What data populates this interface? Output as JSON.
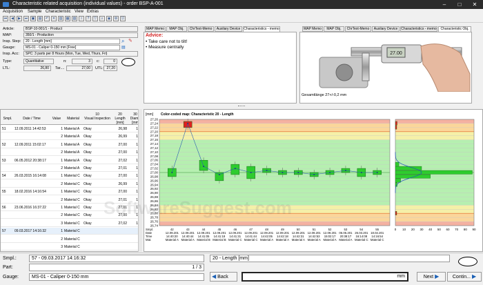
{
  "window": {
    "title": "Characteristic related acquisition (individual values) - order BSP-A-001"
  },
  "menu": [
    "Acquisition",
    "Sample",
    "Characteristic",
    "View",
    "Extras"
  ],
  "header": {
    "article_label": "Article:",
    "article": "BSP-10-001/1 - Product",
    "map_label": "MAP:",
    "map": "350/1 - Production",
    "insp_step_label": "Insp. Step:",
    "insp_step": "20 - Length [mm]",
    "gauge_label": "Gauge:",
    "gauge": "MS-01 - Caliper 0-150 mm [Free]",
    "insp_acc_label": "Insp. Acc:",
    "insp_acc": "SPC: 3 parts per 8 Hours (Mon, Tue, Wed, Thurs, Fri)",
    "type_label": "Type:",
    "type": "Quantitative",
    "n_label": "n:",
    "n": "3",
    "c_label": "c:",
    "c": "0",
    "ltl_label": "LTL:",
    "ltl": "26,80",
    "tar_label": "Tar....",
    "tar": "27,00",
    "utl_label": "UTL:",
    "utl": "27,20"
  },
  "middle_panel": {
    "tabs": [
      "MAP Memo",
      "MAP Obj.",
      "ChrText-Memo",
      "Auxilary Device",
      "Characteristics - memo"
    ],
    "advice_title": "Advice:",
    "advice_items": [
      "Take care not to tilt!",
      "Measure centrally"
    ]
  },
  "right_panel": {
    "tabs": [
      "MAP Memo",
      "MAP Obj.",
      "ChrText-Memo",
      "Auxilary Device",
      "Characteristics - memo",
      "Characteristic Obj."
    ],
    "caption": "Gesamtlänge 27+/-0,2 mm",
    "caliper_display": "27.00"
  },
  "table": {
    "headers": {
      "smpl": "Smpl.",
      "datetime": "Date / Time",
      "value": "Value",
      "material": "Material",
      "visual_no": "10",
      "visual": "Visual Inspection",
      "length_no": "20",
      "length": "Length [mm]",
      "diam_no": "30",
      "diam": "Diame [mm"
    },
    "rows": [
      {
        "smpl": "51",
        "date": "12.09.2011 14:42:53",
        "v": "1",
        "mat": "Material A",
        "vis": "Okay",
        "len": "26,98",
        "d": "1"
      },
      {
        "smpl": "",
        "date": "",
        "v": "2",
        "mat": "Material A",
        "vis": "Okay",
        "len": "26,99",
        "d": "1"
      },
      {
        "smpl": "52",
        "date": "12.09.2011 15:02:17",
        "v": "1",
        "mat": "Material A",
        "vis": "Okay",
        "len": "27,00",
        "d": "1"
      },
      {
        "smpl": "",
        "date": "",
        "v": "2",
        "mat": "Material A",
        "vis": "Okay",
        "len": "27,00",
        "d": "1"
      },
      {
        "smpl": "53",
        "date": "06.05.2012 20:38:17",
        "v": "1",
        "mat": "Material A",
        "vis": "Okay",
        "len": "27,02",
        "d": "1"
      },
      {
        "smpl": "",
        "date": "",
        "v": "2",
        "mat": "Material A",
        "vis": "Okay",
        "len": "27,01",
        "d": "1"
      },
      {
        "smpl": "54",
        "date": "26.03.2015 16:14:08",
        "v": "1",
        "mat": "Material C",
        "vis": "Okay",
        "len": "27,00",
        "d": "1"
      },
      {
        "smpl": "",
        "date": "",
        "v": "2",
        "mat": "Material C",
        "vis": "Okay",
        "len": "26,99",
        "d": "1"
      },
      {
        "smpl": "55",
        "date": "18.02.2016 14:16:54",
        "v": "1",
        "mat": "Material C",
        "vis": "Okay",
        "len": "27,00",
        "d": "1"
      },
      {
        "smpl": "",
        "date": "",
        "v": "2",
        "mat": "Material C",
        "vis": "Okay",
        "len": "27,01",
        "d": "1"
      },
      {
        "smpl": "56",
        "date": "23.06.2016 16:37:22",
        "v": "1",
        "mat": "Material C",
        "vis": "Okay",
        "len": "27,01",
        "d": "1"
      },
      {
        "smpl": "",
        "date": "",
        "v": "2",
        "mat": "Material C",
        "vis": "Okay",
        "len": "27,00",
        "d": "1"
      },
      {
        "smpl": "",
        "date": "",
        "v": "3",
        "mat": "Material C",
        "vis": "Okay",
        "len": "27,02",
        "d": "1"
      },
      {
        "smpl": "57",
        "date": "09.03.2017 14:16:32",
        "v": "1",
        "mat": "Material C",
        "vis": "",
        "len": "",
        "d": ""
      },
      {
        "smpl": "",
        "date": "",
        "v": "2",
        "mat": "Material C",
        "vis": "",
        "len": "",
        "d": ""
      },
      {
        "smpl": "",
        "date": "",
        "v": "3",
        "mat": "Material C",
        "vis": "",
        "len": "",
        "d": ""
      }
    ]
  },
  "chart_data": {
    "type": "box",
    "title": "Color-coded map: Characteristic 20 - Length",
    "ylabel": "[mm]",
    "ylim": [
      26.74,
      27.26
    ],
    "yticks": [
      "27,26",
      "27,24",
      "27,22",
      "27,20",
      "27,18",
      "27,16",
      "27,14",
      "27,12",
      "27,10",
      "27,08",
      "27,06",
      "27,04",
      "27,02",
      "27,00",
      "26,98",
      "26,96",
      "26,94",
      "26,92",
      "26,90",
      "26,88",
      "26,86",
      "26,84",
      "26,82",
      "26,80",
      "26,78",
      "26,76",
      "26,74"
    ],
    "spec": {
      "ltl": 26.8,
      "target": 27.0,
      "utl": 27.2
    },
    "row_labels": [
      "Smpl.",
      "Date",
      "Time",
      "Mat."
    ],
    "samples": [
      {
        "smpl": "42",
        "date": "12.09.201",
        "time": "14:40:20",
        "mat": "Material A",
        "mean": 27.0,
        "min": 26.98,
        "max": 27.02,
        "alarm": false
      },
      {
        "smpl": "43",
        "date": "12.09.201",
        "time": "14:40:44",
        "mat": "Material A",
        "mean": 27.24,
        "min": 27.22,
        "max": 27.25,
        "alarm": true
      },
      {
        "smpl": "44",
        "date": "12.09.201",
        "time": "14:41:05",
        "mat": "Material B",
        "mean": 27.03,
        "min": 27.01,
        "max": 27.06,
        "alarm": false
      },
      {
        "smpl": "45",
        "date": "12.09.201",
        "time": "14:41:18",
        "mat": "Material B",
        "mean": 26.99,
        "min": 26.96,
        "max": 27.0,
        "alarm": false
      },
      {
        "smpl": "46",
        "date": "12.09.201",
        "time": "14:41:31",
        "mat": "Material C",
        "mean": 27.02,
        "min": 26.99,
        "max": 27.04,
        "alarm": false
      },
      {
        "smpl": "47",
        "date": "12.09.201",
        "time": "14:41:44",
        "mat": "Material C",
        "mean": 27.0,
        "min": 26.97,
        "max": 27.03,
        "alarm": false
      },
      {
        "smpl": "48",
        "date": "12.09.201",
        "time": "14:42:05",
        "mat": "Material A",
        "mean": 27.01,
        "min": 27.0,
        "max": 27.02,
        "alarm": false
      },
      {
        "smpl": "49",
        "date": "12.09.201",
        "time": "14:42:18",
        "mat": "Material A",
        "mean": 27.0,
        "min": 26.99,
        "max": 27.01,
        "alarm": false
      },
      {
        "smpl": "50",
        "date": "12.09.201",
        "time": "14:42:31",
        "mat": "Material A",
        "mean": 27.0,
        "min": 26.99,
        "max": 27.01,
        "alarm": false
      },
      {
        "smpl": "51",
        "date": "12.09.201",
        "time": "14:42:53",
        "mat": "Material A",
        "mean": 26.99,
        "min": 26.98,
        "max": 27.0,
        "alarm": false
      },
      {
        "smpl": "52",
        "date": "12.09.201",
        "time": "15:02:17",
        "mat": "Material A",
        "mean": 27.0,
        "min": 26.99,
        "max": 27.01,
        "alarm": false
      },
      {
        "smpl": "53",
        "date": "06.05.201",
        "time": "20:38:17",
        "mat": "Material A",
        "mean": 27.01,
        "min": 27.0,
        "max": 27.02,
        "alarm": false
      },
      {
        "smpl": "54",
        "date": "26.03.201",
        "time": "16:14:08",
        "mat": "Material C",
        "mean": 27.0,
        "min": 26.98,
        "max": 27.02,
        "alarm": false
      },
      {
        "smpl": "55",
        "date": "18.02.201",
        "time": "14:16:54",
        "mat": "Material C",
        "mean": 27.0,
        "min": 26.99,
        "max": 27.01,
        "alarm": false
      }
    ],
    "histogram": {
      "xticks": [
        "0",
        "10",
        "20",
        "30",
        "40",
        "50",
        "60",
        "70",
        "80",
        "90"
      ],
      "bins": [
        {
          "y": 27.24,
          "count": 2,
          "alarm": true
        },
        {
          "y": 27.22,
          "count": 1,
          "alarm": true
        },
        {
          "y": 27.04,
          "count": 4,
          "alarm": false
        },
        {
          "y": 27.02,
          "count": 30,
          "alarm": false
        },
        {
          "y": 27.0,
          "count": 88,
          "alarm": false
        },
        {
          "y": 26.98,
          "count": 40,
          "alarm": false
        },
        {
          "y": 26.96,
          "count": 6,
          "alarm": false
        },
        {
          "y": 26.94,
          "count": 2,
          "alarm": false
        },
        {
          "y": 26.8,
          "count": 1,
          "alarm": true
        }
      ]
    },
    "colors": {
      "red": "#f4b1a1",
      "orange": "#fbd69a",
      "yellow": "#f5f0a8",
      "green": "#b6efb0",
      "box": "#2ecc2e",
      "alarm": "#e02020"
    }
  },
  "status": {
    "smpl_label": "Smpl.:",
    "smpl": "57 - 09.03.2017 14:16:32",
    "part_label": "Part:",
    "part": "1 / 3",
    "gauge_label": "Gauge:",
    "gauge": "MS-01 - Caliper 0-150 mm",
    "char": "20 - Length [mm]",
    "unit": "mm",
    "back": "Back",
    "next": "Next",
    "continue": "Contin..."
  },
  "watermark": "SoftwareSuggest.com"
}
